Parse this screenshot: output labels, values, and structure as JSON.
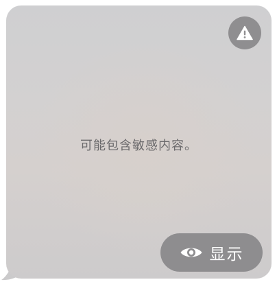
{
  "overlay": {
    "message": "可能包含敏感内容。",
    "show_button_label": "显示",
    "warning_icon": "warning-triangle-icon",
    "show_icon": "eye-icon"
  },
  "colors": {
    "button_background": "#8e8d8f",
    "message_text": "#6b6a6c",
    "button_text": "#ffffff"
  }
}
